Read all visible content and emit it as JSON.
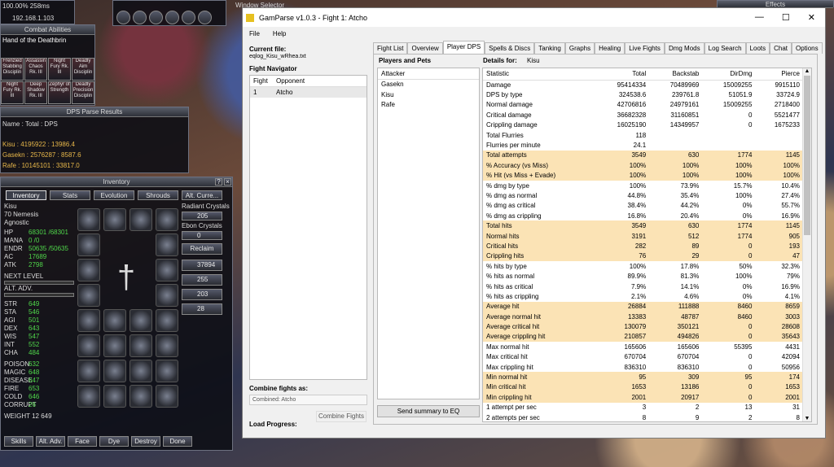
{
  "hud": {
    "status": "100.00%   258ms",
    "ip": "192.168.1.103"
  },
  "combat": {
    "title": "Combat Abilities",
    "spell": "Hand of the Deathbrin",
    "abilities": [
      "Frenzied Stabbing Disciplin",
      "Assassin Chaos Rk. III",
      "Night Fury Rk. III",
      "Deadly Aim Disciplin",
      "Night Fury Rk. III",
      "Deep Shadow Rk. III",
      "Zephyr of Strength",
      "Deadly Precision Disciplin"
    ]
  },
  "window_selector": {
    "title": "Window Selector"
  },
  "effects": {
    "title": "Effects"
  },
  "dps_window": {
    "title": "DPS Parse Results",
    "header": "Name : Total : DPS",
    "lines": [
      "Kisu : 4195922 : 13986.4",
      "Gasekn : 2576287 : 8587.6",
      "Rafe : 10145101 : 33817.0"
    ]
  },
  "inventory": {
    "title": "Inventory",
    "tabs": [
      "Inventory",
      "Stats",
      "Evolution",
      "Shrouds",
      "Alt. Curre..."
    ],
    "name": "Kisu",
    "class": "70 Nemesis",
    "deity": "Agnostic",
    "stats": [
      {
        "k": "HP",
        "v": "68301 /68301"
      },
      {
        "k": "MANA",
        "v": "0 /0"
      },
      {
        "k": "ENDR",
        "v": "50635 /50635"
      },
      {
        "k": "AC",
        "v": "17689"
      },
      {
        "k": "ATK",
        "v": "2798"
      }
    ],
    "next_level": "NEXT LEVEL",
    "alt_adv": "ALT. ADV.",
    "attrs": [
      {
        "k": "STR",
        "v": "649"
      },
      {
        "k": "STA",
        "v": "546"
      },
      {
        "k": "AGI",
        "v": "501"
      },
      {
        "k": "DEX",
        "v": "643"
      },
      {
        "k": "WIS",
        "v": "547"
      },
      {
        "k": "INT",
        "v": "552"
      },
      {
        "k": "CHA",
        "v": "484"
      }
    ],
    "resists": [
      {
        "k": "POISON",
        "v": "632"
      },
      {
        "k": "MAGIC",
        "v": "648"
      },
      {
        "k": "DISEASE",
        "v": "647"
      },
      {
        "k": "FIRE",
        "v": "653"
      },
      {
        "k": "COLD",
        "v": "646"
      },
      {
        "k": "CORRUPT",
        "v": "26"
      }
    ],
    "weight": "WEIGHT   12 649",
    "radiant_label": "Radiant Crystals",
    "radiant": "205",
    "ebon_label": "Ebon Crystals",
    "ebon": "0",
    "reclaim": "Reclaim",
    "coins": [
      "37894",
      "255",
      "203",
      "28"
    ],
    "buttons": [
      "Skills",
      "Alt. Adv.",
      "Face",
      "Dye",
      "Destroy",
      "Done"
    ]
  },
  "gamparse": {
    "title": "GamParse v1.0.3 - Fight 1: Atcho",
    "menu": [
      "File",
      "Help"
    ],
    "tabs": [
      "Fight List",
      "Overview",
      "Player DPS",
      "Spells & Discs",
      "Tanking",
      "Graphs",
      "Healing",
      "Live Fights",
      "Dmg Mods",
      "Log Search",
      "Loots",
      "Chat",
      "Options"
    ],
    "current_file_label": "Current file:",
    "current_file": "eqlog_Kisu_wRhea.txt",
    "fight_nav_label": "Fight Navigator",
    "fight_cols": [
      "Fight",
      "Opponent"
    ],
    "fights": [
      {
        "fight": "1",
        "opponent": "Atcho"
      }
    ],
    "combine_label": "Combine fights as:",
    "combine_value": "Combined: Atcho",
    "combine_button": "Combine Fights",
    "load_progress": "Load Progress:",
    "players_label": "Players and Pets",
    "details_label": "Details for:",
    "details_for": "Kisu",
    "attackers_header": "Attacker",
    "attackers": [
      "Gasekn",
      "Kisu",
      "Rafe"
    ],
    "send_button": "Send summary to EQ",
    "stat_cols": [
      "Statistic",
      "Total",
      "Backstab",
      "DirDmg",
      "Pierce"
    ],
    "stats": [
      {
        "s": "Damage",
        "t": "95414334",
        "b": "70489969",
        "d": "15009255",
        "p": "9915110",
        "h": false
      },
      {
        "s": "DPS by type",
        "t": "324538.6",
        "b": "239761.8",
        "d": "51051.9",
        "p": "33724.9",
        "h": false
      },
      {
        "s": "Normal damage",
        "t": "42706816",
        "b": "24979161",
        "d": "15009255",
        "p": "2718400",
        "h": false
      },
      {
        "s": "Critical damage",
        "t": "36682328",
        "b": "31160851",
        "d": "0",
        "p": "5521477",
        "h": false
      },
      {
        "s": "Crippling damage",
        "t": "16025190",
        "b": "14349957",
        "d": "0",
        "p": "1675233",
        "h": false
      },
      {
        "s": "Total Flurries",
        "t": "118",
        "b": "",
        "d": "",
        "p": "",
        "h": false
      },
      {
        "s": "Flurries per minute",
        "t": "24.1",
        "b": "",
        "d": "",
        "p": "",
        "h": false
      },
      {
        "s": "Total attempts",
        "t": "3549",
        "b": "630",
        "d": "1774",
        "p": "1145",
        "h": true
      },
      {
        "s": "% Accuracy (vs Miss)",
        "t": "100%",
        "b": "100%",
        "d": "100%",
        "p": "100%",
        "h": true
      },
      {
        "s": "% Hit (vs Miss + Evade)",
        "t": "100%",
        "b": "100%",
        "d": "100%",
        "p": "100%",
        "h": true
      },
      {
        "s": "% dmg by type",
        "t": "100%",
        "b": "73.9%",
        "d": "15.7%",
        "p": "10.4%",
        "h": false
      },
      {
        "s": "% dmg as normal",
        "t": "44.8%",
        "b": "35.4%",
        "d": "100%",
        "p": "27.4%",
        "h": false
      },
      {
        "s": "% dmg as critical",
        "t": "38.4%",
        "b": "44.2%",
        "d": "0%",
        "p": "55.7%",
        "h": false
      },
      {
        "s": "% dmg as crippling",
        "t": "16.8%",
        "b": "20.4%",
        "d": "0%",
        "p": "16.9%",
        "h": false
      },
      {
        "s": "Total hits",
        "t": "3549",
        "b": "630",
        "d": "1774",
        "p": "1145",
        "h": true
      },
      {
        "s": "Normal hits",
        "t": "3191",
        "b": "512",
        "d": "1774",
        "p": "905",
        "h": true
      },
      {
        "s": "Critical hits",
        "t": "282",
        "b": "89",
        "d": "0",
        "p": "193",
        "h": true
      },
      {
        "s": "Crippling hits",
        "t": "76",
        "b": "29",
        "d": "0",
        "p": "47",
        "h": true
      },
      {
        "s": "% hits by type",
        "t": "100%",
        "b": "17.8%",
        "d": "50%",
        "p": "32.3%",
        "h": false
      },
      {
        "s": "% hits as normal",
        "t": "89.9%",
        "b": "81.3%",
        "d": "100%",
        "p": "79%",
        "h": false
      },
      {
        "s": "% hits as critical",
        "t": "7.9%",
        "b": "14.1%",
        "d": "0%",
        "p": "16.9%",
        "h": false
      },
      {
        "s": "% hits as crippling",
        "t": "2.1%",
        "b": "4.6%",
        "d": "0%",
        "p": "4.1%",
        "h": false
      },
      {
        "s": "Average hit",
        "t": "26884",
        "b": "111888",
        "d": "8460",
        "p": "8659",
        "h": true
      },
      {
        "s": "Average normal hit",
        "t": "13383",
        "b": "48787",
        "d": "8460",
        "p": "3003",
        "h": true
      },
      {
        "s": "Average critical hit",
        "t": "130079",
        "b": "350121",
        "d": "0",
        "p": "28608",
        "h": true
      },
      {
        "s": "Average crippling hit",
        "t": "210857",
        "b": "494826",
        "d": "0",
        "p": "35643",
        "h": true
      },
      {
        "s": "Max normal hit",
        "t": "165606",
        "b": "165606",
        "d": "55395",
        "p": "4431",
        "h": false
      },
      {
        "s": "Max critical hit",
        "t": "670704",
        "b": "670704",
        "d": "0",
        "p": "42094",
        "h": false
      },
      {
        "s": "Max crippling hit",
        "t": "836310",
        "b": "836310",
        "d": "0",
        "p": "50956",
        "h": false
      },
      {
        "s": "Min normal hit",
        "t": "95",
        "b": "309",
        "d": "95",
        "p": "174",
        "h": true
      },
      {
        "s": "Min critical hit",
        "t": "1653",
        "b": "13186",
        "d": "0",
        "p": "1653",
        "h": true
      },
      {
        "s": "Min crippling hit",
        "t": "2001",
        "b": "20917",
        "d": "0",
        "p": "2001",
        "h": true
      },
      {
        "s": "1 attempt per sec",
        "t": "3",
        "b": "2",
        "d": "13",
        "p": "31",
        "h": false
      },
      {
        "s": "2 attempts per sec",
        "t": "8",
        "b": "9",
        "d": "2",
        "p": "8",
        "h": false
      }
    ]
  }
}
